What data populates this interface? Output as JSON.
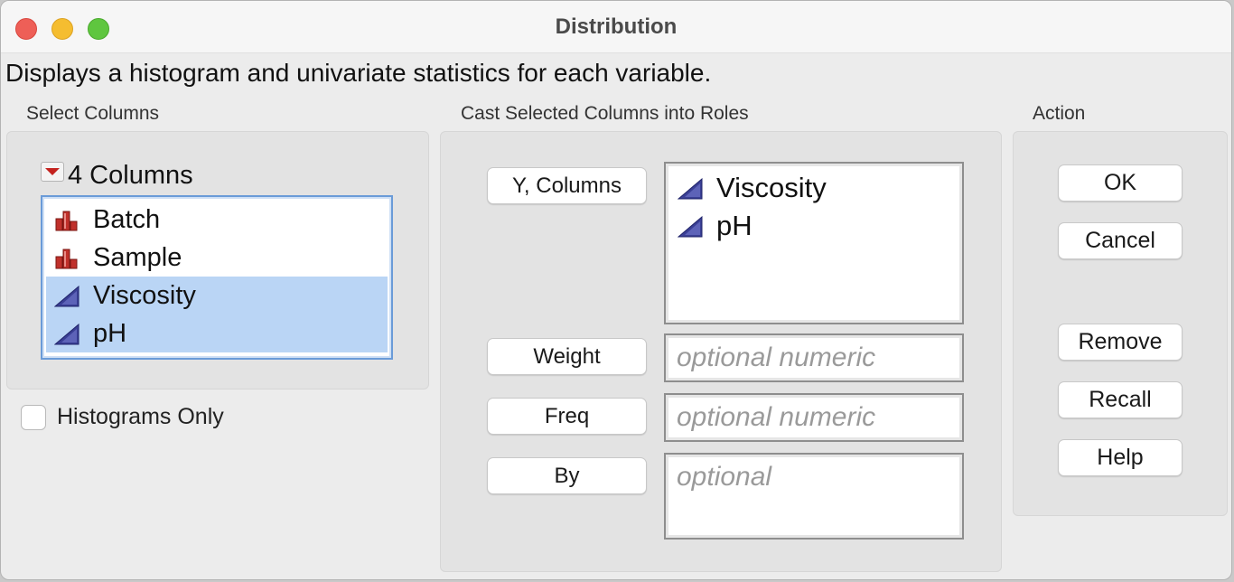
{
  "window": {
    "title": "Distribution"
  },
  "description": "Displays a histogram and univariate statistics for each variable.",
  "select_columns": {
    "label": "Select Columns",
    "header": "4 Columns",
    "columns": [
      {
        "name": "Batch",
        "type_icon": "nominal-bar-icon",
        "selected": false
      },
      {
        "name": "Sample",
        "type_icon": "nominal-bar-icon",
        "selected": false
      },
      {
        "name": "Viscosity",
        "type_icon": "continuous-triangle-icon",
        "selected": true
      },
      {
        "name": "pH",
        "type_icon": "continuous-triangle-icon",
        "selected": true
      }
    ],
    "histograms_only": {
      "label": "Histograms Only",
      "checked": false
    }
  },
  "cast_roles": {
    "label": "Cast Selected Columns into Roles",
    "roles": [
      {
        "button": "Y, Columns",
        "items": [
          "Viscosity",
          "pH"
        ],
        "placeholder": ""
      },
      {
        "button": "Weight",
        "items": [],
        "placeholder": "optional numeric"
      },
      {
        "button": "Freq",
        "items": [],
        "placeholder": "optional numeric"
      },
      {
        "button": "By",
        "items": [],
        "placeholder": "optional"
      }
    ]
  },
  "action": {
    "label": "Action",
    "buttons": [
      "OK",
      "Cancel",
      "Remove",
      "Recall",
      "Help"
    ]
  },
  "colors": {
    "selection": "#bad5f5",
    "list_focus_border": "#6a9bd8",
    "nominal_icon": "#c0302b",
    "continuous_icon": "#3a3f95",
    "disclosure_triangle": "#c4231f"
  }
}
